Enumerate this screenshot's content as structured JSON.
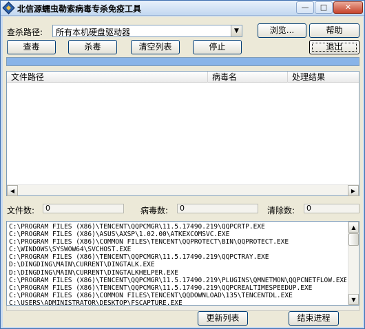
{
  "window": {
    "title": "北信源蠕虫勒索病毒专杀免疫工具",
    "min_glyph": "—",
    "max_glyph": "□",
    "close_glyph": "✕"
  },
  "scan": {
    "path_label": "查杀路径:",
    "path_value": "所有本机硬盘驱动器",
    "arrow_glyph": "▼"
  },
  "buttons": {
    "browse": "浏览...",
    "help": "帮助",
    "scan": "查毒",
    "kill": "杀毒",
    "clear_list": "清空列表",
    "stop": "停止",
    "exit": "退出",
    "refresh_list": "更新列表",
    "end_process": "结束进程"
  },
  "table": {
    "headers": [
      "文件路径",
      "病毒名",
      "处理结果"
    ],
    "scroll_left_glyph": "◀",
    "scroll_right_glyph": "▶"
  },
  "counts": {
    "file_label": "文件数:",
    "file_value": "0",
    "virus_label": "病毒数:",
    "virus_value": "0",
    "cleared_label": "清除数:",
    "cleared_value": "0"
  },
  "log": {
    "lines": [
      "C:\\PROGRAM FILES (X86)\\TENCENT\\QQPCMGR\\11.5.17490.219\\QQPCRTP.EXE",
      "C:\\PROGRAM FILES (X86)\\ASUS\\AXSP\\1.02.00\\ATKEXCOMSVC.EXE",
      "C:\\PROGRAM FILES (X86)\\COMMON FILES\\TENCENT\\QQPROTECT\\BIN\\QQPROTECT.EXE",
      "C:\\WINDOWS\\SYSWOW64\\SVCHOST.EXE",
      "C:\\PROGRAM FILES (X86)\\TENCENT\\QQPCMGR\\11.5.17490.219\\QQPCTRAY.EXE",
      "D:\\DINGDING\\MAIN\\CURRENT\\DINGTALK.EXE",
      "D:\\DINGDING\\MAIN\\CURRENT\\DINGTALKHELPER.EXE",
      "C:\\PROGRAM FILES (X86)\\TENCENT\\QQPCMGR\\11.5.17490.219\\PLUGINS\\QMNETMON\\QQPCNETFLOW.EXE",
      "C:\\PROGRAM FILES (X86)\\TENCENT\\QQPCMGR\\11.5.17490.219\\QQPCREALTIMESPEEDUP.EXE",
      "C:\\PROGRAM FILES (X86)\\COMMON FILES\\TENCENT\\QQDOWNLOAD\\135\\TENCENTDL.EXE",
      "C:\\USERS\\ADMINISTRATOR\\DESKTOP\\FSCAPTURE.EXE"
    ],
    "scroll_up_glyph": "▲",
    "scroll_down_glyph": "▼"
  }
}
